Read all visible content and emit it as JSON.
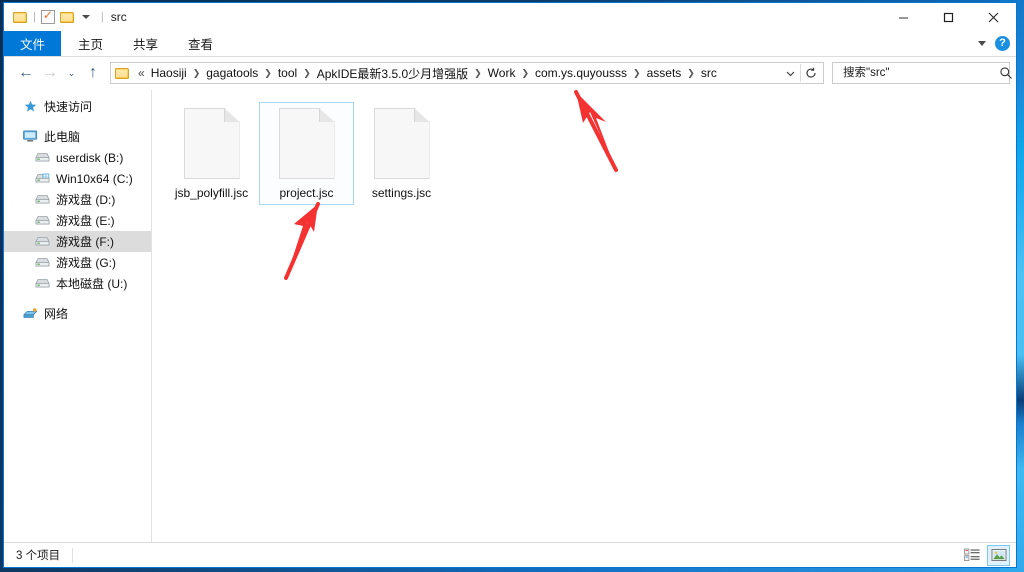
{
  "window": {
    "title": "src",
    "quick_access": [
      "folder-icon",
      "properties-icon",
      "new-folder-icon"
    ],
    "controls": {
      "minimize": "minimize-icon",
      "maximize": "maximize-icon",
      "close": "close-icon"
    }
  },
  "ribbon": {
    "tabs": [
      {
        "label": "文件",
        "active": true
      },
      {
        "label": "主页",
        "active": false
      },
      {
        "label": "共享",
        "active": false
      },
      {
        "label": "查看",
        "active": false
      }
    ],
    "expand_icon": "chevron-down-icon",
    "help_label": "?"
  },
  "navbar": {
    "back": "←",
    "forward": "→",
    "recent": "⌄",
    "up": "↑",
    "breadcrumb_lead": "«",
    "breadcrumb": [
      "Haosiji",
      "gagatools",
      "tool",
      "ApkIDE最新3.5.0少月增强版",
      "Work",
      "com.ys.quyousss",
      "assets",
      "src"
    ],
    "dropdown_icon": "chevron-down-icon",
    "refresh_icon": "refresh-icon"
  },
  "search": {
    "placeholder": "搜索\"src\"",
    "value": "",
    "icon": "search-icon"
  },
  "sidebar": {
    "items": [
      {
        "label": "快速访问",
        "icon": "star-icon",
        "level": 0,
        "selected": false
      },
      {
        "label": "此电脑",
        "icon": "computer-icon",
        "level": 0,
        "selected": false
      },
      {
        "label": "userdisk (B:)",
        "icon": "drive-icon",
        "level": 1,
        "selected": false
      },
      {
        "label": "Win10x64 (C:)",
        "icon": "system-drive-icon",
        "level": 1,
        "selected": false
      },
      {
        "label": "游戏盘 (D:)",
        "icon": "drive-icon",
        "level": 1,
        "selected": false
      },
      {
        "label": "游戏盘 (E:)",
        "icon": "drive-icon",
        "level": 1,
        "selected": false
      },
      {
        "label": "游戏盘 (F:)",
        "icon": "drive-icon",
        "level": 1,
        "selected": true
      },
      {
        "label": "游戏盘 (G:)",
        "icon": "drive-icon",
        "level": 1,
        "selected": false
      },
      {
        "label": "本地磁盘 (U:)",
        "icon": "drive-icon",
        "level": 1,
        "selected": false
      },
      {
        "label": "网络",
        "icon": "network-icon",
        "level": 0,
        "selected": false
      }
    ]
  },
  "files": [
    {
      "name": "jsb_polyfill.jsc",
      "icon": "generic-file-icon",
      "selected": false
    },
    {
      "name": "project.jsc",
      "icon": "generic-file-icon",
      "selected": true
    },
    {
      "name": "settings.jsc",
      "icon": "generic-file-icon",
      "selected": false
    }
  ],
  "annotations": [
    {
      "name": "arrow-to-breadcrumb",
      "color": "#f53232"
    },
    {
      "name": "arrow-to-project-file",
      "color": "#f53232"
    }
  ],
  "statusbar": {
    "item_count": "3 个项目",
    "views": [
      {
        "name": "details-view-button",
        "active": false
      },
      {
        "name": "large-icons-view-button",
        "active": true
      }
    ]
  },
  "colors": {
    "accent": "#0078d7",
    "selection_border": "#a8d8f5",
    "annotation": "#f53232",
    "sidebar_selected": "#dcdcdc"
  }
}
